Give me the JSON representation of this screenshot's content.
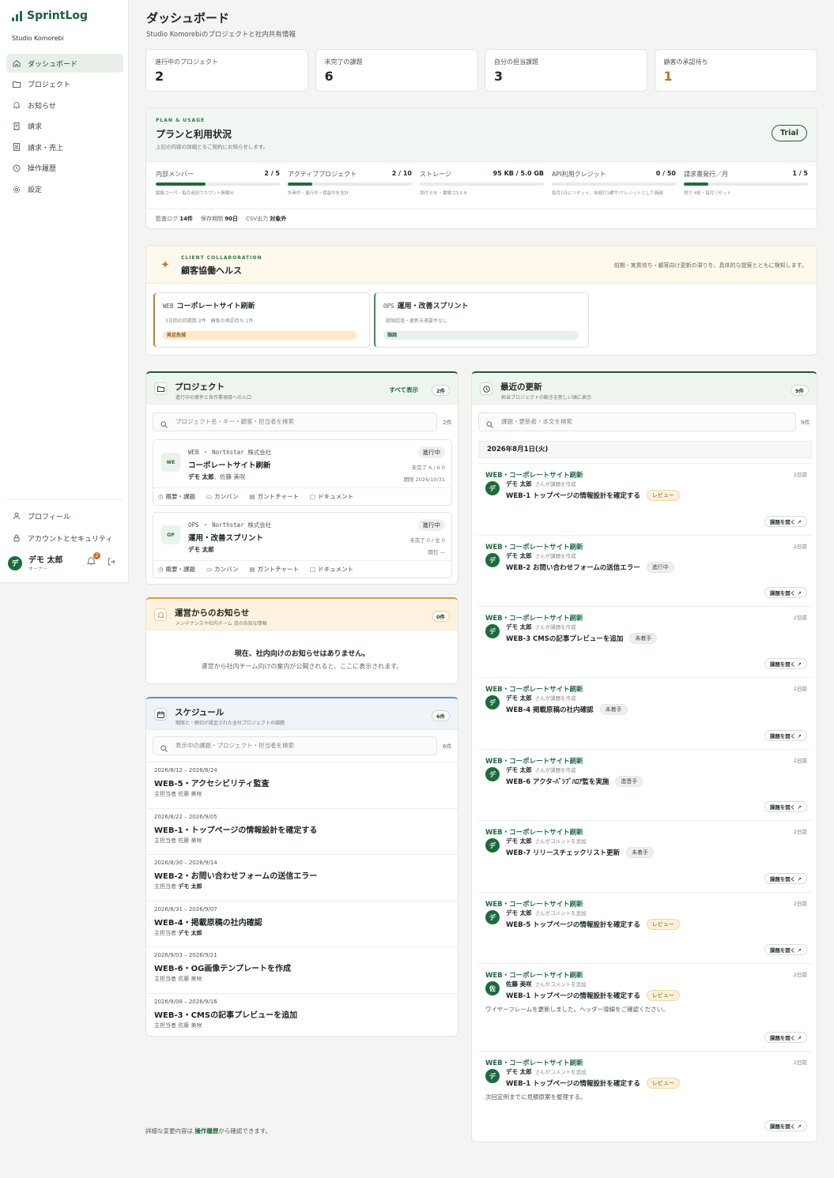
{
  "app": {
    "name": "SprintLog",
    "org": "Studio Komorebi"
  },
  "sidebar": {
    "items": [
      {
        "label": "ダッシュボード",
        "icon": "home-icon"
      },
      {
        "label": "プロジェクト",
        "icon": "folder-icon"
      },
      {
        "label": "お知らせ",
        "icon": "bell-icon"
      },
      {
        "label": "請求",
        "icon": "receipt-icon"
      },
      {
        "label": "請求・売上",
        "icon": "ledger-icon"
      },
      {
        "label": "操作履歴",
        "icon": "history-icon"
      },
      {
        "label": "設定",
        "icon": "gear-icon"
      }
    ],
    "profile": "プロフィール",
    "security": "アカウントとセキュリティ",
    "user": {
      "initial": "デ",
      "name": "デモ 太郎",
      "role": "オーナー",
      "notifications": "2"
    }
  },
  "page": {
    "title": "ダッシュボード",
    "subtitle": "Studio Komorebiのプロジェクトと社内共有情報"
  },
  "stats": [
    {
      "label": "進行中のプロジェクト",
      "value": "2"
    },
    {
      "label": "未完了の課題",
      "value": "6"
    },
    {
      "label": "自分の担当課題",
      "value": "3"
    },
    {
      "label": "顧客の承認待ち",
      "value": "1"
    }
  ],
  "plan": {
    "eyebrow": "PLAN & USAGE",
    "title": "プランと利用状況",
    "subtitle": "上記の内容の詳細とるご契約にお知らせします。",
    "badge": "Trial",
    "usage": [
      {
        "label": "内部メンバー",
        "value": "2 / 5",
        "fraction": 0.4,
        "note": "編集コーパ・毎月追加ウカウント無類分"
      },
      {
        "label": "アクティブプロジェクト",
        "value": "2 / 10",
        "fraction": 0.2,
        "note": "計画中・進行中・保留中を含計"
      },
      {
        "label": "ストレージ",
        "value": "95 KB / 5.0 GB",
        "fraction": 0.0,
        "note": "添付 0 B ・書類コ3 0 8"
      },
      {
        "label": "API利用クレジット",
        "value": "0 / 50",
        "fraction": 0.0,
        "note": "毎月1日にリセット。未超打1曜ザ/クレジットとして繰越"
      },
      {
        "label": "請求書発行／月",
        "value": "1 / 5",
        "fraction": 0.2,
        "note": "残り 4枚・毎月リセット"
      }
    ],
    "footer": [
      {
        "label": "監査ログ",
        "value": "14件"
      },
      {
        "label": "保存期間",
        "value": "90日"
      },
      {
        "label": "CSV出力",
        "value": "対象外"
      }
    ]
  },
  "collab": {
    "eyebrow": "CLIENT COLLABORATION",
    "title": "顧客協働ヘルス",
    "description": "前期・実質待ち・顧客向け更新の滞りを、具体的な提案とともに検知します。",
    "items": [
      {
        "kind": "WEB",
        "name": "コーポレートサイト刷新",
        "meta1": "3日回の回掲数 2件",
        "meta2": "顧客の承認待ち 1件",
        "status": "発足危城"
      },
      {
        "kind": "OPS",
        "name": "運用・改善スプリント",
        "meta1": "期限超過・更新未適要件なし",
        "meta2": "",
        "status": "順調"
      }
    ]
  },
  "projects": {
    "title": "プロジェクト",
    "subtitle": "進行中の案件と各作業項目への入口",
    "view_all": "すべて表示",
    "count": "2件",
    "search_placeholder": "プロジェクト名・キー・顧客・担当者を検索",
    "search_count": "2件",
    "items": [
      {
        "avatar": "WE",
        "kind": "WEB ・ Northstar 株式会社",
        "name": "コーポレートサイト刷新",
        "owner": "デモ 太郎",
        "members": "、佐藤 美咲",
        "status": "進行中",
        "progress": "未完了 6 / 6 0",
        "due": "期限 2026/10/31"
      },
      {
        "avatar": "OP",
        "kind": "OPS ・ Northstar 株式会社",
        "name": "運用・改善スプリント",
        "owner": "デモ 太郎",
        "members": "",
        "status": "進行中",
        "progress": "未完了 0 / 全 0",
        "due": "期日 —"
      }
    ],
    "tabs": [
      "概要・課題",
      "カンバン",
      "ガントチャート",
      "ドキュメント"
    ]
  },
  "notice": {
    "title": "運営からのお知らせ",
    "subtitle": "メンテナンスや社内チーム 追の告知な情報",
    "count": "0件",
    "empty_title": "現在、社内向けのお知らせはありません。",
    "empty_body": "運営から社内チーム向けの案内が公開されると、ここに表示されます。"
  },
  "schedule": {
    "title": "スケジュール",
    "subtitle": "期限と・締切が設定された全社プロジェクトの課題",
    "count": "6件",
    "search_placeholder": "表示中の課題・プロジェクト・担当者を検索",
    "search_count": "6件",
    "owner_label": "主担当者",
    "items": [
      {
        "dates": "2026/8/12 – 2026/8/24",
        "title": "WEB-5・アクセシビリティ監査",
        "owner": "佐藤 美咲",
        "bold": false
      },
      {
        "dates": "2026/8/22 – 2026/9/05",
        "title": "WEB-1・トップページの情報設計を確定する",
        "owner": "佐藤 美咲",
        "bold": false
      },
      {
        "dates": "2026/8/30 – 2026/9/14",
        "title": "WEB-2・お問い合わせフォームの送信エラー",
        "owner": "デモ 太郎",
        "bold": true
      },
      {
        "dates": "2026/8/31 – 2026/9/07",
        "title": "WEB-4・掲載原稿の社内確認",
        "owner": "デモ 太郎",
        "bold": true
      },
      {
        "dates": "2026/9/03 – 2026/9/21",
        "title": "WEB-6・OG画像テンプレートを作成",
        "owner": "佐藤 美咲",
        "bold": false
      },
      {
        "dates": "2026/9/08 – 2026/9/16",
        "title": "WEB-3・CMSの記事プレビューを追加",
        "owner": "佐藤 美咲",
        "bold": false
      }
    ]
  },
  "updates": {
    "title": "最近の更新",
    "subtitle": "担当プロジェクトの動きを新しい順に表示",
    "count": "9件",
    "search_placeholder": "課題・更新者・本文を検索",
    "search_count": "9件",
    "date": "2026年8月1日(火)",
    "open_label": "課題を開く",
    "items": [
      {
        "project": "WEB・コーポレートサイト刷新",
        "ago": "2日前",
        "initial": "デ",
        "user": "デモ 太郎",
        "action": "さんが課題を作成",
        "title": "WEB-1 トップページの情報設計を確定する",
        "badge": "レビュー",
        "badge_type": "rev",
        "comment": ""
      },
      {
        "project": "WEB・コーポレートサイト刷新",
        "ago": "2日前",
        "initial": "デ",
        "user": "デモ 太郎",
        "action": "さんが課題を作成",
        "title": "WEB-2 お問い合わせフォームの送信エラー",
        "badge": "進行中",
        "badge_type": "prog",
        "comment": ""
      },
      {
        "project": "WEB・コーポレートサイト刷新",
        "ago": "2日前",
        "initial": "デ",
        "user": "デモ 太郎",
        "action": "さんが課題を作成",
        "title": "WEB-3 CMSの記事プレビューを追加",
        "badge": "未着手",
        "badge_type": "todo",
        "comment": ""
      },
      {
        "project": "WEB・コーポレートサイト刷新",
        "ago": "2日前",
        "initial": "デ",
        "user": "デモ 太郎",
        "action": "さんが課題を作成",
        "title": "WEB-4 掲載原稿の社内確認",
        "badge": "未着手",
        "badge_type": "todo",
        "comment": ""
      },
      {
        "project": "WEB・コーポレートサイト刷新",
        "ago": "2日前",
        "initial": "デ",
        "user": "デモ 太郎",
        "action": "さんが課題を作成",
        "title": "WEB-6 アクタ-ﾊﾞｼﾌﾞﾊﾛｱ監を実施",
        "badge": "進晋手",
        "badge_type": "todo",
        "comment": ""
      },
      {
        "project": "WEB・コーポレートサイト刷新",
        "ago": "2日前",
        "initial": "デ",
        "user": "デモ 太郎",
        "action": "さんがコメントを追加",
        "title": "WEB-7 リリースチェックリスト更新",
        "badge": "未着手",
        "badge_type": "todo",
        "comment": ""
      },
      {
        "project": "WEB・コーポレートサイト刷新",
        "ago": "2日前",
        "initial": "デ",
        "user": "デモ 太郎",
        "action": "さんがコメントを追加",
        "title": "WEB-5 トップページの情報設計を確定する",
        "badge": "レビュー",
        "badge_type": "rev",
        "comment": ""
      },
      {
        "project": "WEB・コーポレートサイト刷新",
        "ago": "2日前",
        "initial": "佐",
        "user": "佐藤 美咲",
        "action": "さんがコメントを追加",
        "title": "WEB-1 トップページの情報設計を確定する",
        "badge": "レビュー",
        "badge_type": "rev",
        "comment": "ワイヤーフレームを更新しました。ヘッダー導線をご確認ください。"
      },
      {
        "project": "WEB・コーポレートサイト刷新",
        "ago": "2日前",
        "initial": "デ",
        "user": "デモ 太郎",
        "action": "さんがコメントを追加",
        "title": "WEB-1 トップページの情報設計を確定する",
        "badge": "レビュー",
        "badge_type": "rev",
        "comment": "次回定例までに見積原案を整理する。"
      }
    ]
  },
  "footer": {
    "prefix": "詳細な変更内容は ",
    "link": "操作履歴",
    "suffix": "から確認できます。"
  },
  "colors": {
    "brand": "#1f6b3c",
    "warning": "#d9682b",
    "review_bg": "#fbf0d8"
  }
}
